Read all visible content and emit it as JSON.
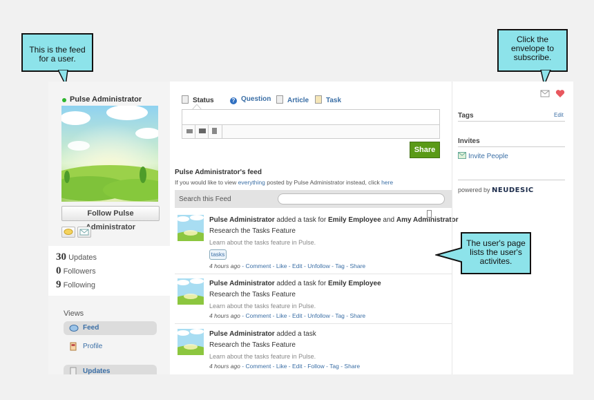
{
  "callouts": {
    "feed_note": "This is the feed for a user.",
    "subscribe_note": "Click the envelope to subscribe.",
    "activity_note": "The user's page lists the user's activites."
  },
  "profile": {
    "name": "Pulse Administrator",
    "status_color": "#2db52d",
    "follow_button": "Follow Pulse Administrator",
    "stats": [
      {
        "count": "30",
        "label": "Updates"
      },
      {
        "count": "0",
        "label": "Followers"
      },
      {
        "count": "9",
        "label": "Following"
      }
    ],
    "views_title": "Views",
    "views": [
      {
        "label": "Feed",
        "active": true,
        "icon": "feed-icon"
      },
      {
        "label": "Profile",
        "active": false,
        "icon": "profile-icon"
      },
      {
        "label": "Updates",
        "active": true,
        "icon": "updates-icon"
      }
    ]
  },
  "composer": {
    "tabs": [
      {
        "label": "Status",
        "icon": "status-icon"
      },
      {
        "label": "Question",
        "icon": "question-icon"
      },
      {
        "label": "Article",
        "icon": "article-icon"
      },
      {
        "label": "Task",
        "icon": "task-icon"
      }
    ],
    "share_label": "Share",
    "attach_icons": [
      "video-icon",
      "image-icon",
      "file-icon"
    ]
  },
  "feed": {
    "title": "Pulse Administrator's feed",
    "subtitle_pre": "If you would like to view ",
    "subtitle_link": "everything",
    "subtitle_mid": " posted by Pulse Administrator instead, click ",
    "subtitle_link2": "here",
    "search_label": "Search this Feed",
    "entries": [
      {
        "actor": "Pulse Administrator",
        "verb": " added a task for ",
        "target1": "Emily Employee",
        "conj": " and ",
        "target2": "Amy Administrator",
        "task": "Research the Tasks Feature",
        "desc": "Learn about the tasks feature in Pulse.",
        "tag": "tasks",
        "time": "4 hours ago",
        "actions": " - Comment - Like - Edit - Unfollow - Tag - Share"
      },
      {
        "actor": "Pulse Administrator",
        "verb": " added a task for ",
        "target1": "Emily Employee",
        "task": "Research the Tasks Feature",
        "desc": "Learn about the tasks feature in Pulse.",
        "time": "4 hours ago",
        "actions": " - Comment - Like - Edit - Unfollow - Tag - Share"
      },
      {
        "actor": "Pulse Administrator",
        "verb": " added a task",
        "task": "Research the Tasks Feature",
        "desc": "Learn about the tasks feature in Pulse.",
        "time": "4 hours ago",
        "actions": " - Comment - Like - Edit - Follow - Tag - Share"
      }
    ]
  },
  "sidebar_right": {
    "tags_title": "Tags",
    "edit_label": "Edit",
    "invites_title": "Invites",
    "invite_label": "Invite People",
    "powered_by": "powered by",
    "brand": "NEUDESIC"
  },
  "colors": {
    "callout_bg": "#8de3ea",
    "link": "#3a6ea5",
    "share_green": "#5a9a17"
  }
}
